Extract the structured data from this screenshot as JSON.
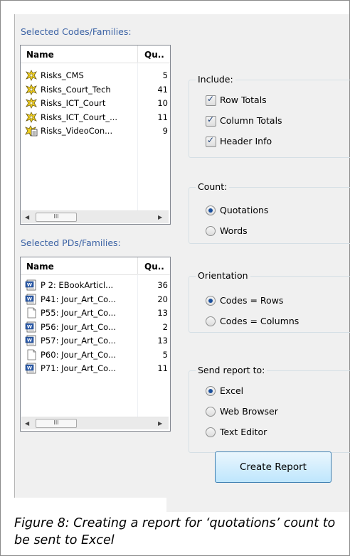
{
  "codes_panel": {
    "label": "Selected Codes/Families:",
    "col_name": "Name",
    "col_qty": "Qu..",
    "rows": [
      {
        "name": "Risks_CMS",
        "qty": "5",
        "icon": "code-icon"
      },
      {
        "name": "Risks_Court_Tech",
        "qty": "41",
        "icon": "code-icon"
      },
      {
        "name": "Risks_ICT_Court",
        "qty": "10",
        "icon": "code-icon"
      },
      {
        "name": "Risks_ICT_Court_...",
        "qty": "11",
        "icon": "code-icon"
      },
      {
        "name": "Risks_VideoCon...",
        "qty": "9",
        "icon": "code-memo-icon"
      }
    ],
    "scroll_thumb": "III"
  },
  "pds_panel": {
    "label": "Selected PDs/Families:",
    "col_name": "Name",
    "col_qty": "Qu..",
    "rows": [
      {
        "name": "P 2: EBookArticl...",
        "qty": "36",
        "icon": "word-doc-icon"
      },
      {
        "name": "P41: Jour_Art_Co...",
        "qty": "20",
        "icon": "word-doc-icon"
      },
      {
        "name": "P55: Jour_Art_Co...",
        "qty": "13",
        "icon": "blank-doc-icon"
      },
      {
        "name": "P56: Jour_Art_Co...",
        "qty": "2",
        "icon": "word-doc-icon"
      },
      {
        "name": "P57: Jour_Art_Co...",
        "qty": "13",
        "icon": "word-doc-icon"
      },
      {
        "name": "P60: Jour_Art_Co...",
        "qty": "5",
        "icon": "blank-doc-icon"
      },
      {
        "name": "P71: Jour_Art_Co...",
        "qty": "11",
        "icon": "word-doc-icon"
      }
    ],
    "scroll_thumb": "III"
  },
  "include": {
    "title": "Include:",
    "row_totals": "Row Totals",
    "column_totals": "Column Totals",
    "header_info": "Header Info"
  },
  "count": {
    "title": "Count:",
    "quotations": "Quotations",
    "words": "Words",
    "selected": "quotations"
  },
  "orientation": {
    "title": "Orientation",
    "codes_rows": "Codes = Rows",
    "codes_columns": "Codes = Columns",
    "selected": "codes_rows"
  },
  "send_report": {
    "title": "Send report to:",
    "excel": "Excel",
    "web_browser": "Web Browser",
    "text_editor": "Text Editor",
    "selected": "excel"
  },
  "create_report_label": "Create Report",
  "caption": "Figure 8: Creating a report for ‘quotations’ count to be sent to Excel",
  "colors": {
    "section_label": "#3c63a5",
    "button_border": "#3c7fb1",
    "radio_dot": "#1a4f9c"
  }
}
